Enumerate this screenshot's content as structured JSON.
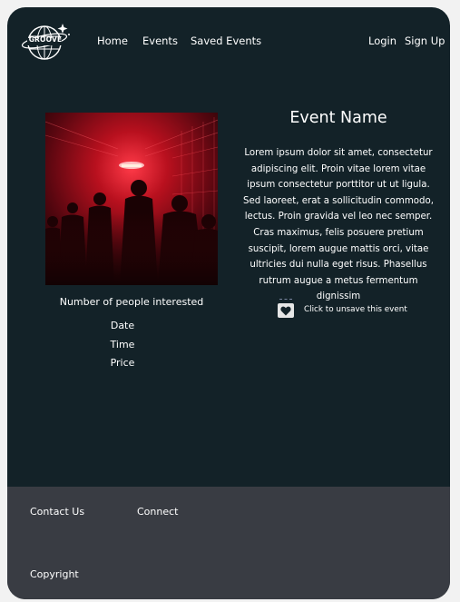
{
  "brand": {
    "logo_text": "GROOVE"
  },
  "nav": {
    "home": "Home",
    "events": "Events",
    "saved_events": "Saved Events",
    "login": "Login",
    "signup": "Sign Up"
  },
  "event": {
    "title": "Event Name",
    "description": "Lorem ipsum dolor sit amet, consectetur adipiscing elit. Proin vitae lorem vitae ipsum consectetur porttitor ut ut ligula. Sed laoreet, erat a sollicitudin commodo, lectus. Proin gravida vel leo nec semper. Cras maximus, felis posuere pretium suscipit, lorem augue mattis orci, vitae ultricies dui nulla eget risus. Phasellus rutrum augue a metus fermentum dignissim",
    "interested_label": "Number of people interested",
    "date_label": "Date",
    "time_label": "Time",
    "price_label": "Price",
    "unsave_label": "Click to unsave this event"
  },
  "footer": {
    "contact": "Contact Us",
    "connect": "Connect",
    "copyright": "Copyright"
  },
  "colors": {
    "background": "#132228",
    "footer": "#393c43",
    "page": "#f2f2f2",
    "text": "#ffffff"
  },
  "icons": {
    "logo": "globe-logo-icon",
    "unsave": "heart-icon"
  }
}
